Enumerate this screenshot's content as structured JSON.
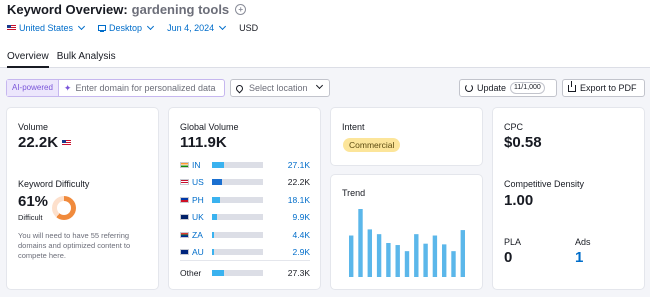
{
  "header": {
    "title": "Keyword Overview:",
    "keyword": "gardening tools",
    "help_symbol": "+",
    "filters": {
      "country": "United States",
      "device": "Desktop",
      "date": "Jun 4, 2024",
      "currency": "USD"
    },
    "tabs": [
      {
        "label": "Overview",
        "active": true
      },
      {
        "label": "Bulk Analysis",
        "active": false
      }
    ]
  },
  "toolbar": {
    "ai_badge": "AI-powered",
    "ai_input_placeholder": "Enter domain for personalized data",
    "location_placeholder": "Select location",
    "update_label": "Update",
    "update_counter": "11/1,000",
    "export_label": "Export to PDF"
  },
  "volume": {
    "label": "Volume",
    "value": "22.2K"
  },
  "difficulty": {
    "label": "Keyword Difficulty",
    "value": "61%",
    "level": "Difficult",
    "percent": 61,
    "note": "You will need to have 55 referring domains and optimized content to compete here."
  },
  "global_volume": {
    "label": "Global Volume",
    "value": "111.9K",
    "rows": [
      {
        "code": "IN",
        "value": "27.1K",
        "share": 0.24,
        "flag": "in"
      },
      {
        "code": "US",
        "value": "22.2K",
        "share": 0.2,
        "flag": "us"
      },
      {
        "code": "PH",
        "value": "18.1K",
        "share": 0.16,
        "flag": "ph"
      },
      {
        "code": "UK",
        "value": "9.9K",
        "share": 0.09,
        "flag": "uk"
      },
      {
        "code": "ZA",
        "value": "4.4K",
        "share": 0.04,
        "flag": "za"
      },
      {
        "code": "AU",
        "value": "2.9K",
        "share": 0.03,
        "flag": "au"
      }
    ],
    "other": {
      "label": "Other",
      "value": "27.3K",
      "share": 0.24
    }
  },
  "intent": {
    "label": "Intent",
    "value": "Commercial"
  },
  "trend": {
    "label": "Trend",
    "chart_data": {
      "type": "bar",
      "values": [
        0.61,
        1.0,
        0.7,
        0.63,
        0.5,
        0.47,
        0.38,
        0.63,
        0.49,
        0.61,
        0.48,
        0.38,
        0.69
      ]
    }
  },
  "cpc": {
    "label": "CPC",
    "value": "$0.58"
  },
  "competitive_density": {
    "label": "Competitive Density",
    "value": "1.00"
  },
  "pla": {
    "label": "PLA",
    "value": "0"
  },
  "ads": {
    "label": "Ads",
    "value": "1"
  },
  "colors": {
    "link": "#006dca",
    "bar_primary": "#3ab2ef",
    "bar_us": "#1a6fd0",
    "trend_bar": "#5bb7ea",
    "kd_orange": "#f08a3c",
    "intent_yellow": "#fce59a"
  }
}
